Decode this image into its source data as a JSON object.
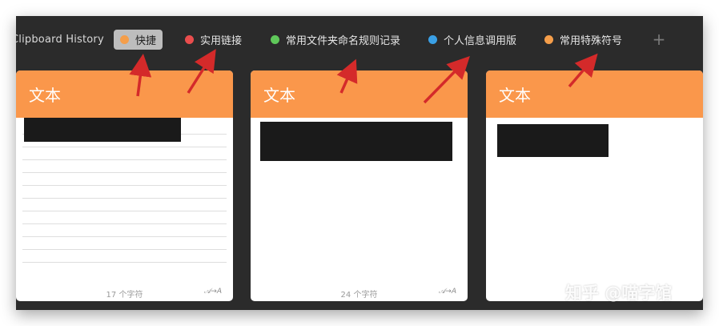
{
  "app": {
    "title": "Clipboard History"
  },
  "tabs": [
    {
      "label": "快捷",
      "color": "#f59e4a",
      "active": true
    },
    {
      "label": "实用链接",
      "color": "#ea4d4d",
      "active": false
    },
    {
      "label": "常用文件夹命名规则记录",
      "color": "#5fc85a",
      "active": false
    },
    {
      "label": "个人信息调用版",
      "color": "#3aa0e6",
      "active": false
    },
    {
      "label": "常用特殊符号",
      "color": "#f59e4a",
      "active": false
    }
  ],
  "add_tab": {
    "label": "+"
  },
  "cards": [
    {
      "type_label": "文本",
      "char_count": "17 个字符",
      "format_icon": "𝒜→A"
    },
    {
      "type_label": "文本",
      "char_count": "24 个字符",
      "format_icon": "𝒜→A"
    },
    {
      "type_label": "文本",
      "char_count": "",
      "format_icon": ""
    }
  ],
  "watermark": {
    "text": "知乎 @喵字馆"
  },
  "colors": {
    "card_header": "#fa974b",
    "window_background": "#2b2b2b",
    "annotation_arrow": "#d42a2a"
  }
}
